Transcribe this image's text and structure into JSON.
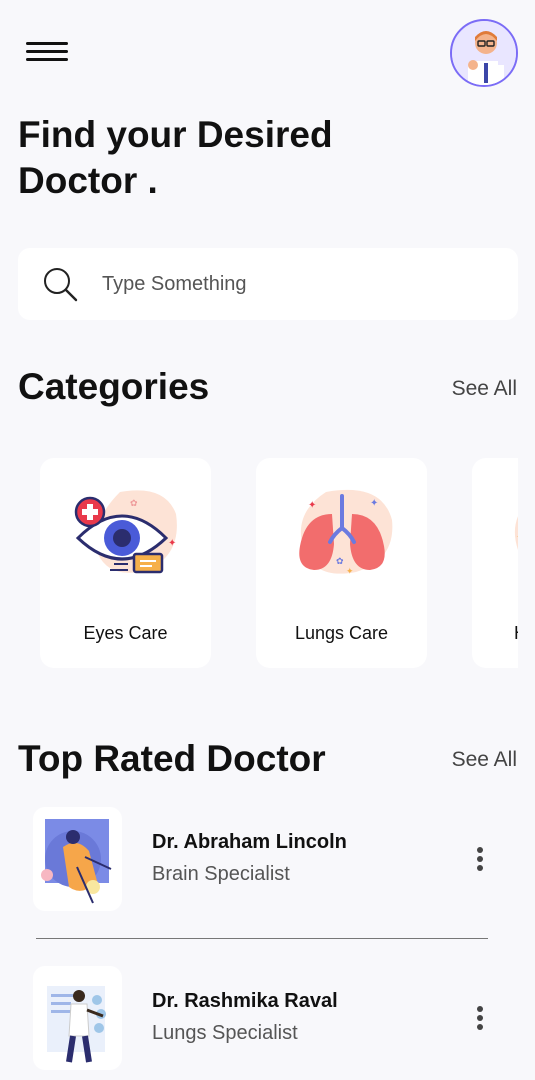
{
  "header": {
    "menu_icon": "hamburger-icon",
    "avatar_icon": "avatar-icon"
  },
  "page_title": "Find your Desired Doctor .",
  "search": {
    "placeholder": "Type Something",
    "icon": "search-icon"
  },
  "categories": {
    "title": "Categories",
    "see_all": "See All",
    "items": [
      {
        "label": "Eyes Care",
        "icon": "eye-icon"
      },
      {
        "label": "Lungs Care",
        "icon": "lungs-icon"
      },
      {
        "label": "H",
        "icon": "heart-icon"
      }
    ]
  },
  "top_rated": {
    "title": "Top Rated Doctor",
    "see_all": "See All",
    "doctors": [
      {
        "name": "Dr. Abraham Lincoln",
        "specialty": "Brain Specialist"
      },
      {
        "name": "Dr. Rashmika Raval",
        "specialty": "Lungs Specialist"
      }
    ]
  },
  "colors": {
    "background": "#f8f8fb",
    "card": "#ffffff",
    "accent": "#7b6cf6",
    "text": "#111111"
  }
}
